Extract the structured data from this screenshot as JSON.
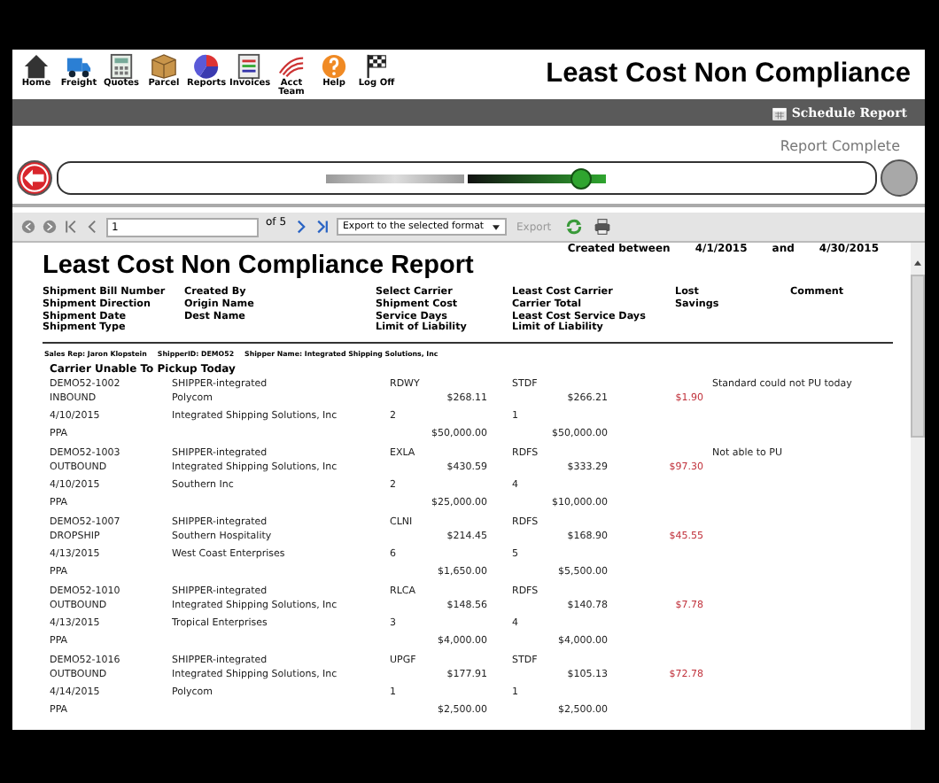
{
  "header": {
    "nav_items": [
      {
        "label": "Home"
      },
      {
        "label": "Freight"
      },
      {
        "label": "Quotes"
      },
      {
        "label": "Parcel"
      },
      {
        "label": "Reports"
      },
      {
        "label": "Invoices"
      },
      {
        "label": "Acct Team"
      },
      {
        "label": "Help"
      },
      {
        "label": "Log Off"
      }
    ],
    "title": "Least Cost Non Compliance"
  },
  "action_bar": {
    "schedule_button": "Schedule Report"
  },
  "progress": {
    "status": "Report Complete"
  },
  "toolbar": {
    "page": "1",
    "page_count": "of 5",
    "export_select": "Export to the selected format",
    "export_button": {
      "label": "Export",
      "disabled": true
    }
  },
  "report": {
    "title": "Least Cost Non Compliance Report",
    "created_label": "Created between",
    "start_date": "4/1/2015",
    "and_label": "and",
    "end_date": "4/30/2015",
    "column_headers": [
      [
        "Shipment Bill Number",
        "Shipment Direction",
        "Shipment Date",
        "Shipment Type"
      ],
      [
        "Created By",
        "Origin Name",
        "Dest Name"
      ],
      [
        "Select Carrier",
        "Shipment Cost",
        "Service Days",
        "Limit of Liability"
      ],
      [
        "Least Cost Carrier",
        "Carrier Total",
        "Least Cost Service Days",
        "Limit of Liability"
      ],
      [
        "Lost",
        "Savings"
      ],
      [
        "Comment"
      ]
    ],
    "filters": [
      "Sales Rep: Jaron Klopstein",
      "ShipperID: DEMO52",
      "Shipper Name: Integrated Shipping Solutions, Inc"
    ],
    "section_title": "Carrier Unable To Pickup Today",
    "records": [
      {
        "bill_number": "DEMO52-1002",
        "created_by": "SHIPPER-integrated",
        "select_carrier": "RDWY",
        "least_cost_carrier": "STDF",
        "comment": "Standard could not PU today",
        "direction": "INBOUND",
        "origin": "Polycom",
        "shipment_cost": "$268.11",
        "carrier_total": "$266.21",
        "lost_savings": "$1.90",
        "date": "4/10/2015",
        "dest": "Integrated Shipping Solutions, Inc",
        "service_days": "2",
        "lc_service_days": "1",
        "type": "PPA",
        "limit": "$50,000.00",
        "lc_limit": "$50,000.00"
      },
      {
        "bill_number": "DEMO52-1003",
        "created_by": "SHIPPER-integrated",
        "select_carrier": "EXLA",
        "least_cost_carrier": "RDFS",
        "comment": "Not able to PU",
        "direction": "OUTBOUND",
        "origin": "Integrated Shipping Solutions, Inc",
        "shipment_cost": "$430.59",
        "carrier_total": "$333.29",
        "lost_savings": "$97.30",
        "date": "4/10/2015",
        "dest": "Southern Inc",
        "service_days": "2",
        "lc_service_days": "4",
        "type": "PPA",
        "limit": "$25,000.00",
        "lc_limit": "$10,000.00"
      },
      {
        "bill_number": "DEMO52-1007",
        "created_by": "SHIPPER-integrated",
        "select_carrier": "CLNI",
        "least_cost_carrier": "RDFS",
        "direction": "DROPSHIP",
        "origin": "Southern Hospitality",
        "shipment_cost": "$214.45",
        "carrier_total": "$168.90",
        "lost_savings": "$45.55",
        "date": "4/13/2015",
        "dest": "West Coast Enterprises",
        "service_days": "6",
        "lc_service_days": "5",
        "type": "PPA",
        "limit": "$1,650.00",
        "lc_limit": "$5,500.00"
      },
      {
        "bill_number": "DEMO52-1010",
        "created_by": "SHIPPER-integrated",
        "select_carrier": "RLCA",
        "least_cost_carrier": "RDFS",
        "direction": "OUTBOUND",
        "origin": "Integrated Shipping Solutions, Inc",
        "shipment_cost": "$148.56",
        "carrier_total": "$140.78",
        "lost_savings": "$7.78",
        "date": "4/13/2015",
        "dest": "Tropical Enterprises",
        "service_days": "3",
        "lc_service_days": "4",
        "type": "PPA",
        "limit": "$4,000.00",
        "lc_limit": "$4,000.00"
      },
      {
        "bill_number": "DEMO52-1016",
        "created_by": "SHIPPER-integrated",
        "select_carrier": "UPGF",
        "least_cost_carrier": "STDF",
        "direction": "OUTBOUND",
        "origin": "Integrated Shipping Solutions, Inc",
        "shipment_cost": "$177.91",
        "carrier_total": "$105.13",
        "lost_savings": "$72.78",
        "date": "4/14/2015",
        "dest": "Polycom",
        "service_days": "1",
        "lc_service_days": "1",
        "type": "PPA",
        "limit": "$2,500.00",
        "lc_limit": "$2,500.00"
      }
    ]
  }
}
